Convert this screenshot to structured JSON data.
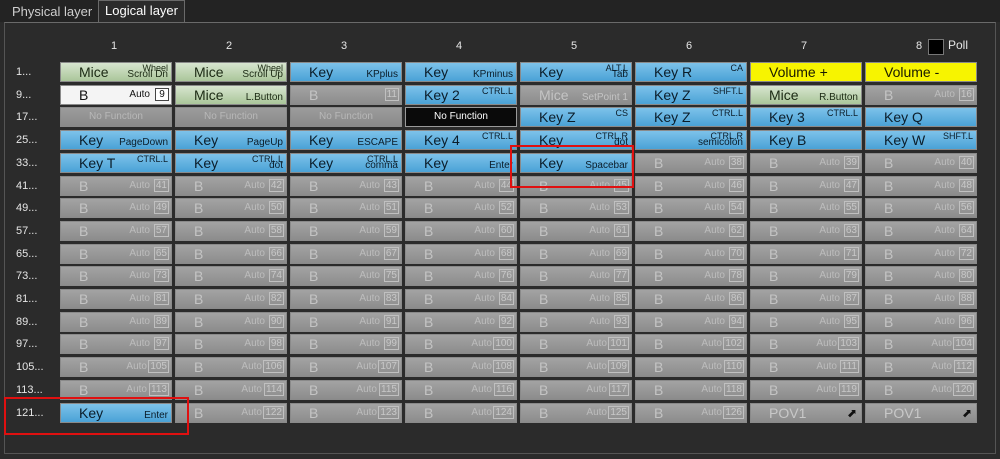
{
  "tabs": [
    {
      "label": "Physical layer",
      "active": false
    },
    {
      "label": "Logical layer",
      "active": true
    }
  ],
  "columns": [
    "1",
    "2",
    "3",
    "4",
    "5",
    "6",
    "7",
    "8"
  ],
  "poll_label": "Poll",
  "row_labels": [
    "1...",
    "9...",
    "17...",
    "25...",
    "33...",
    "41...",
    "49...",
    "57...",
    "65...",
    "73...",
    "81...",
    "89...",
    "97...",
    "105...",
    "113...",
    "121..."
  ],
  "colors": {
    "key_blue": "#4aa2d6",
    "mice_green": "#aac69a",
    "volume_yellow": "#f7f400",
    "highlight_red": "#e01010"
  },
  "cells": [
    {
      "type": "green",
      "main": "Mice",
      "sub": "Scroll Dn",
      "sup": "Wheel"
    },
    {
      "type": "green",
      "main": "Mice",
      "sub": "Scroll Up",
      "sup": "Wheel"
    },
    {
      "type": "blue",
      "main": "Key",
      "sub": "KPplus"
    },
    {
      "type": "blue",
      "main": "Key",
      "sub": "KPminus"
    },
    {
      "type": "blue",
      "main": "Key",
      "sub": "Tab",
      "sup": "ALT.L"
    },
    {
      "type": "blue",
      "main": "Key R",
      "sup": "CA"
    },
    {
      "type": "yellow",
      "main": "Volume +"
    },
    {
      "type": "yellow",
      "main": "Volume -"
    },
    {
      "type": "white",
      "main": "B",
      "lbl": "Auto",
      "box": "9"
    },
    {
      "type": "green",
      "main": "Mice",
      "sub": "L.Button"
    },
    {
      "type": "auto",
      "main": "B",
      "box": "11"
    },
    {
      "type": "blue",
      "main": "Key 2",
      "sup": "CTRL.L"
    },
    {
      "type": "setpt",
      "main": "Mice",
      "sub": "SetPoint 1"
    },
    {
      "type": "blue",
      "main": "Key Z",
      "sup": "SHFT.L"
    },
    {
      "type": "green",
      "main": "Mice",
      "sub": "R.Button"
    },
    {
      "type": "auto",
      "main": "B",
      "lbl": "Auto",
      "box": "16"
    },
    {
      "type": "nofn",
      "center": "No Function"
    },
    {
      "type": "nofn",
      "center": "No Function"
    },
    {
      "type": "nofn",
      "center": "No Function"
    },
    {
      "type": "black",
      "center": "No Function"
    },
    {
      "type": "blue",
      "main": "Key Z",
      "sup": "CS"
    },
    {
      "type": "blue",
      "main": "Key Z",
      "sup": "CTRL.L"
    },
    {
      "type": "blue",
      "main": "Key 3",
      "sup": "CTRL.L"
    },
    {
      "type": "blue",
      "main": "Key Q"
    },
    {
      "type": "blue",
      "main": "Key",
      "sub": "PageDown"
    },
    {
      "type": "blue",
      "main": "Key",
      "sub": "PageUp"
    },
    {
      "type": "blue",
      "main": "Key",
      "sub": "ESCAPE"
    },
    {
      "type": "blue",
      "main": "Key 4",
      "sup": "CTRL.L"
    },
    {
      "type": "blue",
      "main": "Key",
      "sub": "dot",
      "sup": "CTRL.R"
    },
    {
      "type": "blue",
      "main": "",
      "sub": "semicolon",
      "sup": "CTRL.R"
    },
    {
      "type": "blue",
      "main": "Key B"
    },
    {
      "type": "blue",
      "main": "Key W",
      "sup": "SHFT.L"
    },
    {
      "type": "blue",
      "main": "Key T",
      "sup": "CTRL.L"
    },
    {
      "type": "blue",
      "main": "Key",
      "sub": "dot",
      "sup": "CTRL.L"
    },
    {
      "type": "blue",
      "main": "Key",
      "sub": "comma",
      "sup": "CTRL.L"
    },
    {
      "type": "blue",
      "main": "Key",
      "sub": "Enter"
    },
    {
      "type": "blue",
      "main": "Key",
      "sub": "Spacebar"
    },
    {
      "type": "auto",
      "main": "B",
      "lbl": "Auto",
      "box": "38"
    },
    {
      "type": "auto",
      "main": "B",
      "lbl": "Auto",
      "box": "39"
    },
    {
      "type": "auto",
      "main": "B",
      "lbl": "Auto",
      "box": "40"
    }
  ],
  "auto_label": "Auto",
  "auto_main": "B",
  "auto_start": 41,
  "auto_end": 120,
  "last_row": [
    {
      "type": "blue",
      "main": "Key",
      "sub": "Enter"
    },
    {
      "type": "auto",
      "main": "B",
      "lbl": "Auto",
      "box": "122"
    },
    {
      "type": "auto",
      "main": "B",
      "lbl": "Auto",
      "box": "123"
    },
    {
      "type": "auto",
      "main": "B",
      "lbl": "Auto",
      "box": "124"
    },
    {
      "type": "auto",
      "main": "B",
      "lbl": "Auto",
      "box": "125"
    },
    {
      "type": "auto",
      "main": "B",
      "lbl": "Auto",
      "box": "126"
    },
    {
      "type": "pov",
      "main": "POV1",
      "arrow": "⬈"
    },
    {
      "type": "pov",
      "main": "POV1",
      "arrow": "⬈"
    }
  ]
}
